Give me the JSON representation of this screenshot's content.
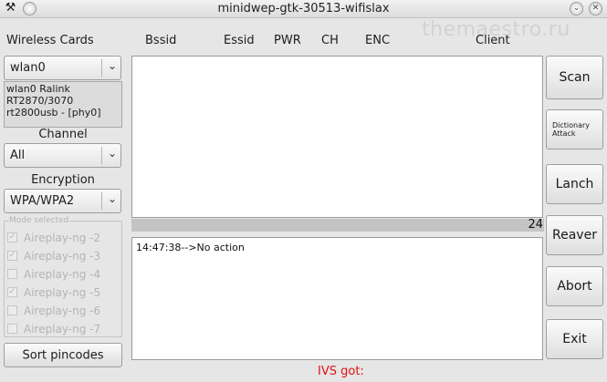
{
  "window": {
    "title": "minidwep-gtk-30513-wifislax",
    "close_glyph": "✕",
    "watermark": "themaestro.ru",
    "left_icons": [
      {
        "icon": "tools-icon",
        "glyph": "⚒"
      },
      {
        "icon": "menu-icon",
        "glyph": "○"
      }
    ],
    "right_icons": [
      {
        "icon": "minimize-icon",
        "glyph": "⌄"
      },
      {
        "icon": "close-icon",
        "glyph": "✕"
      }
    ]
  },
  "sidebar": {
    "wireless_cards_label": "Wireless Cards",
    "wireless_card_selected": "wlan0",
    "card_info": [
      "wlan0 Ralink",
      "RT2870/3070",
      "rt2800usb - [phy0]"
    ],
    "channel_label": "Channel",
    "channel_selected": "All",
    "encryption_label": "Encryption",
    "encryption_selected": "WPA/WPA2",
    "mode_selected_legend": "Mode selected",
    "modes": [
      {
        "label": "Aireplay-ng -2",
        "checked": true
      },
      {
        "label": "Aireplay-ng -3",
        "checked": true
      },
      {
        "label": "Aireplay-ng -4",
        "checked": false
      },
      {
        "label": "Aireplay-ng -5",
        "checked": true
      },
      {
        "label": "Aireplay-ng -6",
        "checked": false
      },
      {
        "label": "Aireplay-ng -7",
        "checked": false
      }
    ],
    "sort_pincodes_label": "Sort pincodes"
  },
  "table": {
    "columns": [
      "Bssid",
      "Essid",
      "PWR",
      "CH",
      "ENC",
      "Client"
    ],
    "rows": []
  },
  "progress": {
    "value_text": "24"
  },
  "log": {
    "lines": [
      "14:47:38-->No action"
    ]
  },
  "buttons": {
    "scan": "Scan",
    "dictionary_attack": "Dictionary Attack",
    "launch": "Lanch",
    "reaver": "Reaver",
    "abort": "Abort",
    "exit": "Exit"
  },
  "status": {
    "ivs_label": "IVS got:"
  },
  "colors": {
    "status_text": "#e31010",
    "window_bg": "#e6e6e6"
  }
}
